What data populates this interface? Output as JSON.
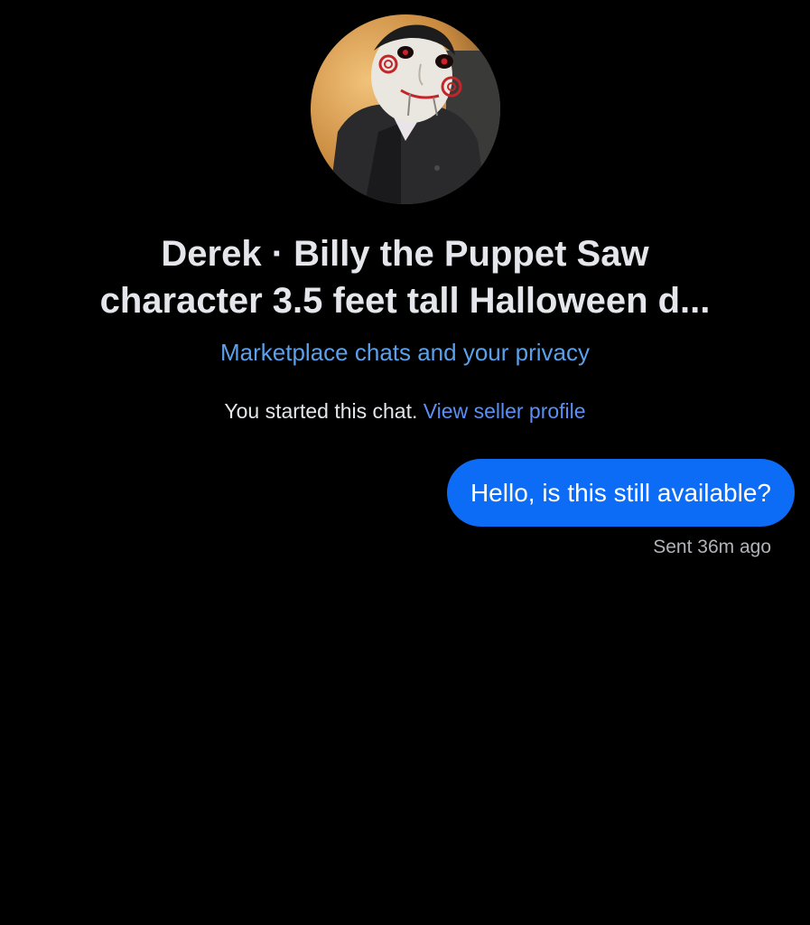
{
  "header": {
    "avatar_icon": "billy-puppet-avatar",
    "title_line1": "Derek · Billy the Puppet Saw",
    "title_line2": "character 3.5 feet tall Halloween d...",
    "privacy_link": "Marketplace chats and your privacy"
  },
  "info": {
    "started_text": "You started this chat.",
    "seller_link": "View seller profile"
  },
  "messages": [
    {
      "text": "Hello, is this still available?",
      "status": "Sent 36m ago",
      "color": "#0c6cf5"
    }
  ],
  "colors": {
    "background": "#000000",
    "link": "#5aa0ea",
    "bubble": "#0c6cf5"
  }
}
